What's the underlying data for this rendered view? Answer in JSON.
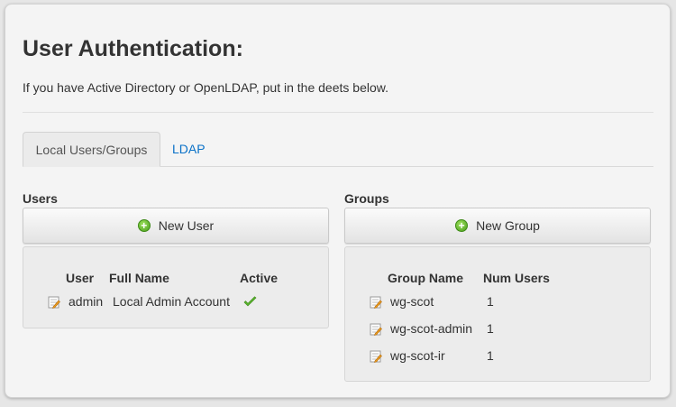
{
  "header": {
    "title": "User Authentication:",
    "subtitle": "If you have Active Directory or OpenLDAP, put in the deets below."
  },
  "tabs": [
    {
      "label": "Local Users/Groups",
      "active": true
    },
    {
      "label": "LDAP",
      "active": false
    }
  ],
  "users": {
    "section_label": "Users",
    "new_button_label": "New User",
    "columns": [
      "User",
      "Full Name",
      "Active"
    ],
    "rows": [
      {
        "user": "admin",
        "full_name": "Local Admin Account",
        "active": true
      }
    ]
  },
  "groups": {
    "section_label": "Groups",
    "new_button_label": "New Group",
    "columns": [
      "Group Name",
      "Num Users"
    ],
    "rows": [
      {
        "name": "wg-scot",
        "num_users": "1"
      },
      {
        "name": "wg-scot-admin",
        "num_users": "1"
      },
      {
        "name": "wg-scot-ir",
        "num_users": "1"
      }
    ]
  },
  "colors": {
    "link": "#0b72c8",
    "add_icon": "#5bb427",
    "check": "#5ab52d"
  },
  "icons": {
    "add": "plus-circle-icon",
    "edit": "edit-note-icon",
    "active": "checkmark-icon"
  }
}
